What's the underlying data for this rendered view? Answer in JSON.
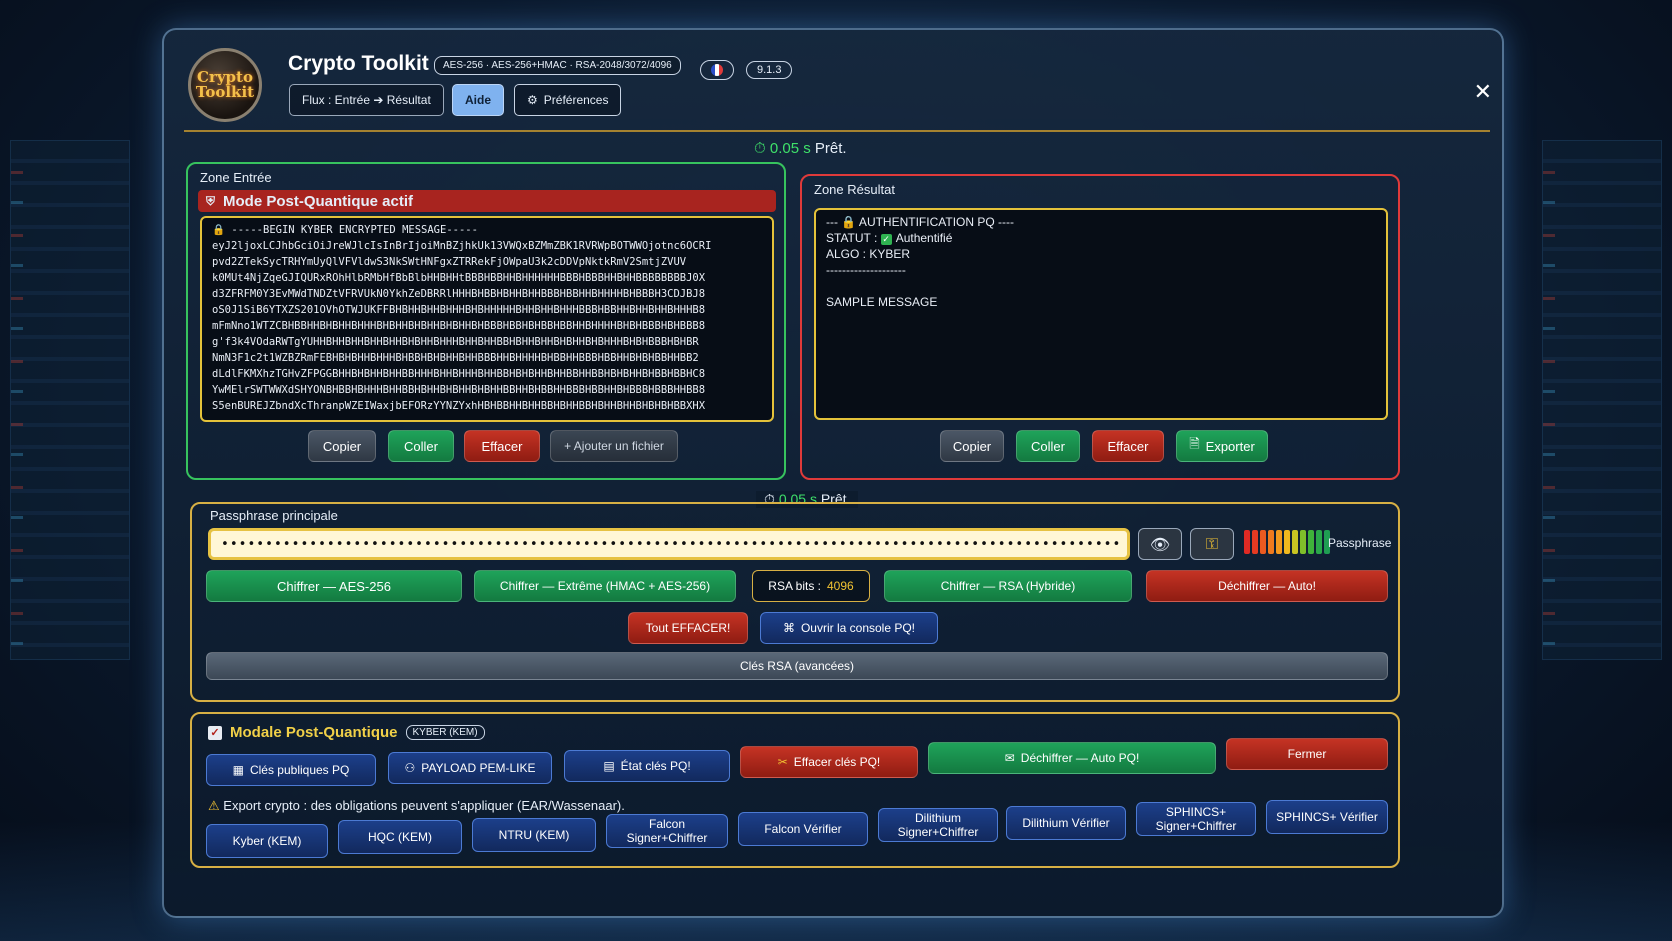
{
  "header": {
    "logo_text": "Crypto Toolkit",
    "title": "Crypto Toolkit",
    "algo_pill": "AES-256 · AES-256+HMAC · RSA-2048/3072/4096",
    "version": "9.1.3",
    "flux_label": "Flux : Entrée ➔ Résultat",
    "help_label": "Aide",
    "prefs_label": "Préférences",
    "close_label": "✕"
  },
  "status_top": {
    "time": "0.05 s",
    "label": "Prêt."
  },
  "status_mid": {
    "time": "0.05 s",
    "label": "Prêt."
  },
  "input_zone": {
    "label": "Zone Entrée",
    "banner": "Mode Post-Quantique actif",
    "content": "🔒 -----BEGIN KYBER ENCRYPTED MESSAGE-----\neyJ2ljoxLCJhbGciOiJreWJlcIsInBrIjoiMnBZjhkUk13VWQxBZMmZBK1RVRWpBOTWWOjotnc6OCRI\npvd2ZTekSycTRHYmUyQlVFVldwS3NkSWtHNFgxZTRRekFjOWpaU3k2cDDVpNktkRmV2SmtjZVUV\nk0MUt4NjZqeGJIQURxROhHlbRMbHfBbBlbHHBHHtBBBHBBHHBHHHHHHBBBHBBBHHBHHBBBBBBBBJ0X\nd3ZFRFM0Y3EvMWdTNDZtVFRVUkN0YkhZeDBRRlHHHBHBBHBHHBHHBBBHBBHHBHHHHBHBBBH3CDJBJ8\noS0J1SiB6YTXZS201OVhOTWJUKFFBHBHHBHHBHHHBHBHHHHHBHHBHHBHHHBBBHBBHHBHHBHHBHHHB8\nmFmNno1WTZCBHBBHHBHBHHBHHHBHBHHBHBHHBHBHHBHBBBHBBHBHBBHBBHHBHHHHBHBHBBBHBHBBB8\ng'f3k4VOdaRWTgYUHHBHHBHHBHHBHHBHBHHBHHHBHHBHHBBHBHHBHHBHBHHBHBHHHBHBHBBBHBHBR\nNmN3F1c2t1WZBZRmFEBHBHBHHBHHHBHBBHBHBHHBHHBBBHHBHHHHBHBBHHBBBHBBHHBHBHBBHHBB2\ndLdlFKMXhzTGHvZFPGGBHHBHBHHBHHBBHHHBHHBHHHBHHBBHBHBHHBHHBBHHBBHBHBHHBHBBHBBHC8\nYwMElrSWTWWXdSHYONBHBBHBHHHBHHBBHBHHBHBHHBHBHHBBHHBHBBHHBBBHBBHHBHBBBHBBBHHBB8\nS5enBUREJZbndXcThranpWZEIWaxjbEFORzYYNZYxhHBHBBHHBHHBBHBHHBBHBHHBHHBHBHBHBBXHX",
    "buttons": {
      "copy": "Copier",
      "paste": "Coller",
      "clear": "Effacer",
      "add_file": "+ Ajouter un fichier"
    }
  },
  "result_zone": {
    "label": "Zone Résultat",
    "line1": "--- 🔒 AUTHENTIFICATION PQ ----",
    "statut_key": "STATUT :",
    "statut_value": "Authentifié",
    "algo_line": "ALGO : KYBER",
    "separator": "--------------------",
    "message": "SAMPLE MESSAGE",
    "buttons": {
      "copy": "Copier",
      "paste": "Coller",
      "clear": "Effacer",
      "export": "Exporter"
    }
  },
  "passphrase": {
    "label": "Passphrase principale",
    "value": "••••••••••••••••••••••••••••••••••••••••••••••••••••••••••••••••••••••••••••••••••••••••••••••••••••••",
    "strength_label": "Passphrase",
    "strength_bars": [
      "#e02a24",
      "#e53a22",
      "#ea5a20",
      "#ef7a1e",
      "#f29a1e",
      "#f0b81e",
      "#c8c422",
      "#7fbf2a",
      "#3fb33a",
      "#2aa84a",
      "#1f9e52"
    ],
    "buttons": {
      "aes": "Chiffrer — AES-256",
      "extreme": "Chiffrer — Extrême (HMAC + AES-256)",
      "rsa_bits_label": "RSA bits :",
      "rsa_bits_value": "4096",
      "rsa": "Chiffrer — RSA (Hybride)",
      "decrypt_auto": "Déchiffrer — Auto!",
      "clear_all": "Tout EFFACER!",
      "open_console": "Ouvrir la console PQ!",
      "rsa_keys": "Clés RSA (avancées)"
    }
  },
  "pq_modal": {
    "title": "Modale Post-Quantique",
    "badge": "KYBER (KEM)",
    "buttons_row1": {
      "public_keys": "Clés publiques PQ",
      "payload": "PAYLOAD PEM-LIKE",
      "keys_state": "État clés PQ!",
      "clear_keys": "Effacer clés PQ!",
      "decrypt_auto_pq": "Déchiffrer — Auto PQ!",
      "close": "Fermer"
    },
    "warning": "Export crypto : des obligations peuvent s'appliquer (EAR/Wassenaar).",
    "algos": [
      {
        "line1": "Kyber (KEM)",
        "line2": ""
      },
      {
        "line1": "HQC (KEM)",
        "line2": ""
      },
      {
        "line1": "NTRU (KEM)",
        "line2": ""
      },
      {
        "line1": "Falcon",
        "line2": "Signer+Chiffrer"
      },
      {
        "line1": "Falcon Vérifier",
        "line2": ""
      },
      {
        "line1": "Dilithium",
        "line2": "Signer+Chiffrer"
      },
      {
        "line1": "Dilithium Vérifier",
        "line2": ""
      },
      {
        "line1": "SPHINCS+",
        "line2": "Signer+Chiffrer"
      },
      {
        "line1": "SPHINCS+ Vérifier",
        "line2": ""
      }
    ]
  },
  "icons": {
    "timer": "stopwatch-icon",
    "prefs": "gear-icon",
    "lock": "lock-icon",
    "eye": "eye-icon",
    "key": "key-icon",
    "warning": "warning-icon"
  }
}
